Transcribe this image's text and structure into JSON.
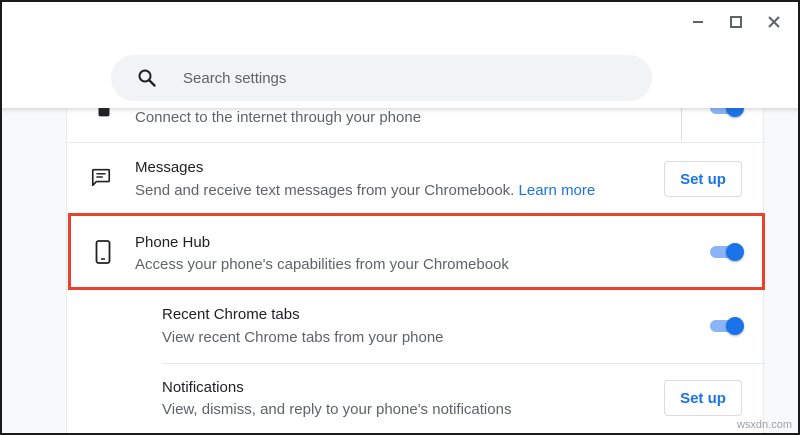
{
  "search": {
    "placeholder": "Search settings"
  },
  "rows": {
    "hotspot": {
      "subtitle": "Connect to the internet through your phone"
    },
    "messages": {
      "title": "Messages",
      "subtitle": "Send and receive text messages from your Chromebook.",
      "link": "Learn more",
      "button": "Set up"
    },
    "phone_hub": {
      "title": "Phone Hub",
      "subtitle": "Access your phone's capabilities from your Chromebook",
      "toggle_on": true
    },
    "recent_tabs": {
      "title": "Recent Chrome tabs",
      "subtitle": "View recent Chrome tabs from your phone",
      "toggle_on": true
    },
    "notifications": {
      "title": "Notifications",
      "subtitle": "View, dismiss, and reply to your phone's notifications",
      "button": "Set up"
    }
  },
  "colors": {
    "accent": "#1a73e8",
    "highlight": "#e8412c",
    "toggle_track": "#8ab4f8"
  },
  "icons": {
    "minimize": "minimize-icon",
    "maximize": "maximize-icon",
    "close": "close-icon",
    "search": "search-icon",
    "messages": "message-icon",
    "phone": "phone-icon"
  },
  "watermark": "wsxdn.com"
}
